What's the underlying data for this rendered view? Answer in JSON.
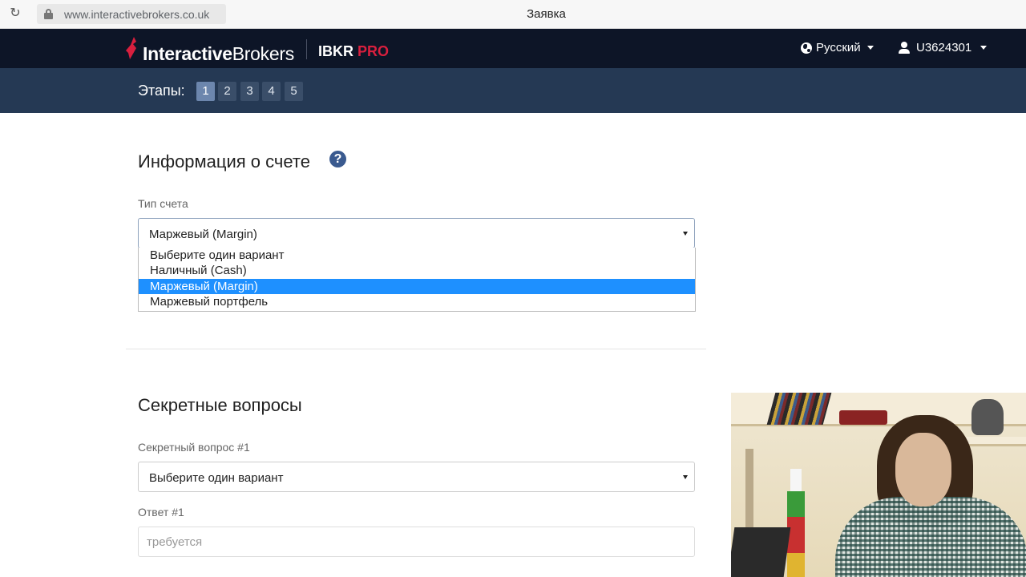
{
  "browser": {
    "url": "www.interactivebrokers.co.uk",
    "tab_title": "Заявка"
  },
  "header": {
    "logo_bold": "Interactive",
    "logo_regular": "Brokers",
    "product_main": "IBKR",
    "product_accent": "PRO",
    "language": "Русский",
    "account_id": "U3624301",
    "colors": {
      "nav_bg": "#0d1527",
      "brand_red": "#d81f3e"
    }
  },
  "steps": {
    "label": "Этапы:",
    "items": [
      "1",
      "2",
      "3",
      "4",
      "5"
    ],
    "active_index": 0
  },
  "account_info": {
    "title": "Информация о счете",
    "account_type_label": "Тип счета",
    "account_type_value": "Маржевый (Margin)",
    "options": [
      "Выберите один вариант",
      "Наличный (Cash)",
      "Маржевый (Margin)",
      "Маржевый портфель"
    ],
    "selected_option_index": 2
  },
  "security_questions": {
    "title": "Секретные вопросы",
    "question1_label": "Секретный вопрос #1",
    "question1_value": "Выберите один вариант",
    "answer1_label": "Ответ #1",
    "answer1_placeholder": "требуется"
  }
}
